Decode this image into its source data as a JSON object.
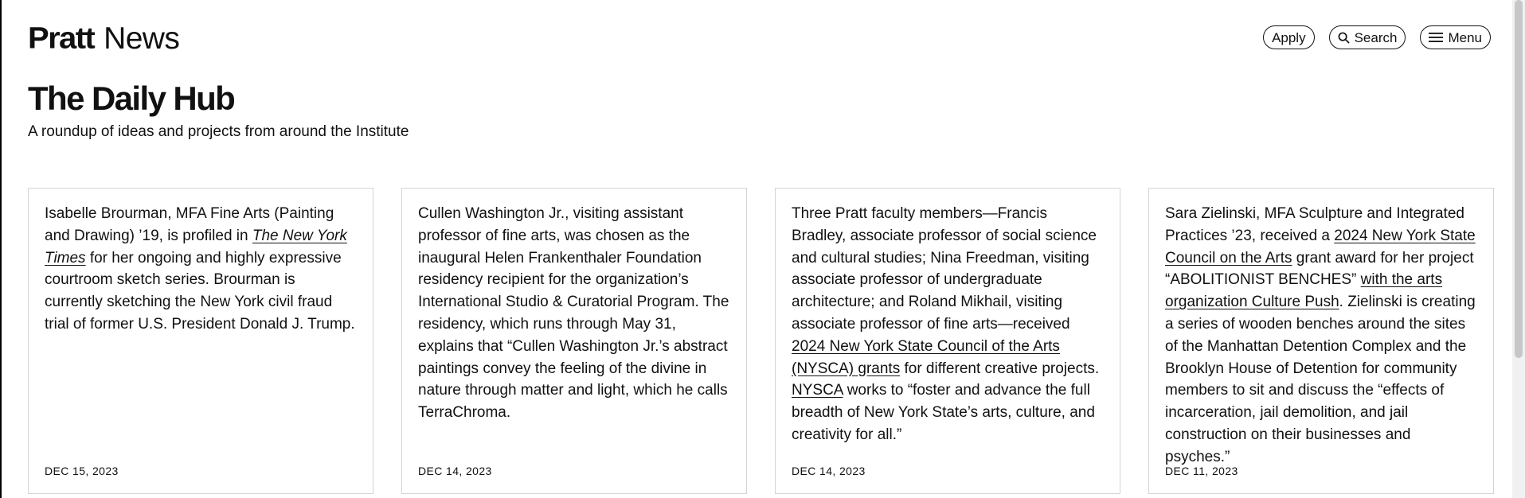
{
  "header": {
    "logo": "Pratt",
    "section": "News",
    "actions": {
      "apply": "Apply",
      "search": "Search",
      "menu": "Menu"
    }
  },
  "hub": {
    "title": "The Daily Hub",
    "subtitle": "A roundup of ideas and projects from around the Institute"
  },
  "cards": [
    {
      "p1": "Isabelle Brourman, MFA Fine Arts (Painting and Drawing) ’19, is profiled in ",
      "link1": "The New York Times",
      "p2": " for her ongoing and highly expressive courtroom sketch series. Brourman is currently sketching the New York civil fraud trial of former U.S. President Donald J. Trump.",
      "date": "DEC 15, 2023"
    },
    {
      "p1": "Cullen Washington Jr., visiting assistant professor of fine arts, was chosen as the inaugural Helen Frankenthaler Foundation residency recipient for the organization’s International Studio & Curatorial Program. The residency, which runs through May 31, explains that “Cullen Washington Jr.’s abstract paintings convey the feeling of the divine in nature through matter and light, which he calls TerraChroma.",
      "date": "DEC 14, 2023"
    },
    {
      "p1": "Three Pratt faculty members—Francis Bradley, associate professor of social science and cultural studies; Nina Freedman, visiting associate professor of undergraduate architecture; and Roland Mikhail, visiting associate professor of fine arts—received ",
      "link1": "2024 New York State Council of the Arts (NYSCA) grants",
      "p2": " for different creative projects. ",
      "link2": "NYSCA",
      "p3": " works to “foster and advance the full breadth of New York State’s arts, culture, and creativity for all.”",
      "date": "DEC 14, 2023"
    },
    {
      "p1": "Sara Zielinski, MFA Sculpture and Integrated Practices ’23, received a ",
      "link1": "2024 New York State Council on the Arts",
      "p2": " grant award for her project “ABOLITIONIST BENCHES” ",
      "link2": "with the arts organization Culture Push",
      "p3": ". Zielinski is creating a series of wooden benches around the sites of the Manhattan Detention Complex and the Brooklyn House of Detention for community members to sit and discuss the “effects of incarceration, jail demolition, and jail construction on their businesses and psyches.”",
      "date": "DEC 11, 2023"
    }
  ]
}
